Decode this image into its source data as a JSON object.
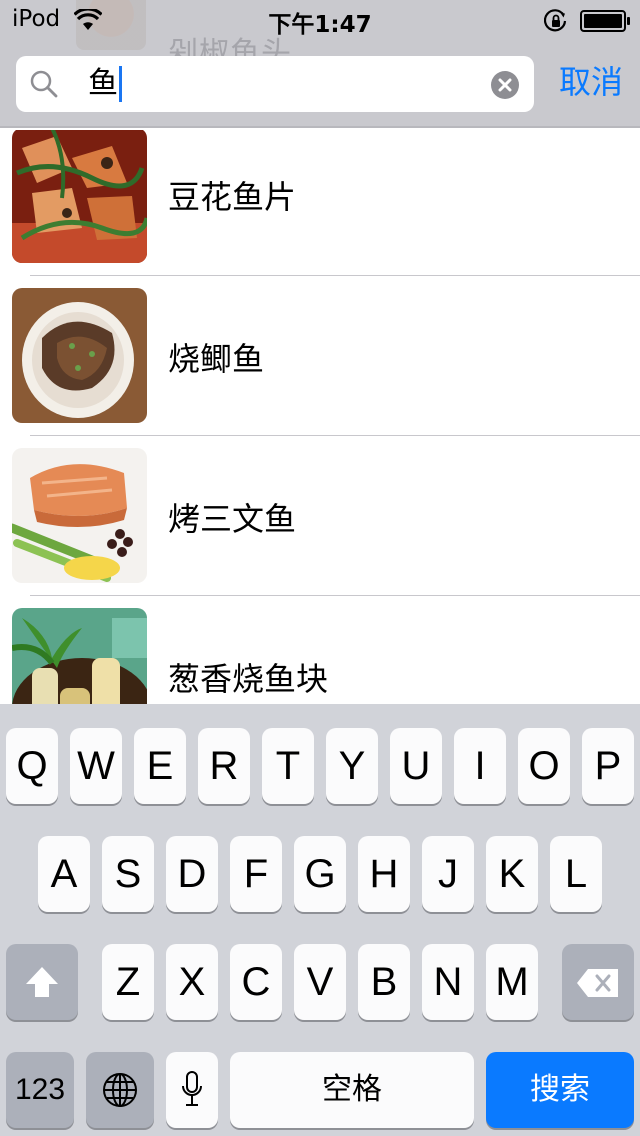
{
  "status_bar": {
    "carrier": "iPod",
    "time": "下午1:47",
    "icons": [
      "wifi-icon",
      "orientation-lock-icon",
      "battery-icon"
    ]
  },
  "behind_header_item": {
    "title": "剁椒鱼头"
  },
  "search": {
    "value": "鱼",
    "cancel_label": "取消"
  },
  "results": [
    {
      "title": "豆花鱼片",
      "thumbnail": "dish-douhua-fish-slices"
    },
    {
      "title": "烧鲫鱼",
      "thumbnail": "dish-braised-crucian-carp"
    },
    {
      "title": "烤三文鱼",
      "thumbnail": "dish-roasted-salmon"
    },
    {
      "title": "葱香烧鱼块",
      "thumbnail": "dish-scallion-fish-chunks"
    }
  ],
  "keyboard": {
    "row1": [
      "Q",
      "W",
      "E",
      "R",
      "T",
      "Y",
      "U",
      "I",
      "O",
      "P"
    ],
    "row2": [
      "A",
      "S",
      "D",
      "F",
      "G",
      "H",
      "J",
      "K",
      "L"
    ],
    "row3": [
      "Z",
      "X",
      "C",
      "V",
      "B",
      "N",
      "M"
    ],
    "numbers_label": "123",
    "space_label": "空格",
    "search_label": "搜索"
  },
  "colors": {
    "accent": "#0a7aff",
    "header_bg": "#c9c9ce",
    "keyboard_bg": "#d1d3d9"
  }
}
